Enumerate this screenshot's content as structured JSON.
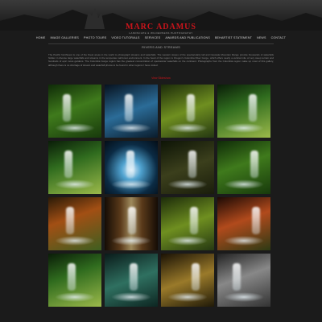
{
  "header": {
    "logo": "MARC ADAMUS",
    "tagline": "LANDSCAPE & WILDERNESS PHOTOGRAPHY"
  },
  "nav": {
    "items": [
      "HOME",
      "IMAGE GALLERIES",
      "PHOTO TOURS",
      "VIDEO TUTORIALS",
      "SERVICES",
      "AWARDS AND PUBLICATIONS",
      "BEHARTIST STATEMENT",
      "NEWS",
      "CONTACT"
    ]
  },
  "gallery": {
    "title": "RIVERS AND STREAMS",
    "intro": "The Pacific Northwest is one of the finest areas in the world to photograph streams and waterfalls. The western slopes of the spectacularly tall and Cascade Mountain Range provide thousands of waterfalls hidden in diverse large waterfalls and streams in the temperate rainforest environment. In the heart of the region is Oregon's Columbia River Gorge, which offers nearly a vertical mile of very steep terrain and hundreds of epic moss gardens. The Columbia Gorge region has the greatest concentration of spectacular waterfalls on the continent. Photographs from the Columbia region make up most of this gallery, although there is no shortage of stream and waterfall photos to be found in other regions I have visited.",
    "view_link": "View Slideshow",
    "thumbs": [
      {
        "style": "t-green"
      },
      {
        "style": "t-blue"
      },
      {
        "style": "t-moss"
      },
      {
        "style": "t-forest"
      },
      {
        "style": "t-forest"
      },
      {
        "style": "t-cave"
      },
      {
        "style": "t-dark"
      },
      {
        "style": "t-green"
      },
      {
        "style": "t-autumn"
      },
      {
        "style": "t-slot"
      },
      {
        "style": "t-moss"
      },
      {
        "style": "t-fire"
      },
      {
        "style": "t-forest"
      },
      {
        "style": "t-teal"
      },
      {
        "style": "t-gold"
      },
      {
        "style": "t-mono"
      }
    ]
  },
  "colors": {
    "accent": "#c9141b",
    "background": "#1b1b1b"
  }
}
